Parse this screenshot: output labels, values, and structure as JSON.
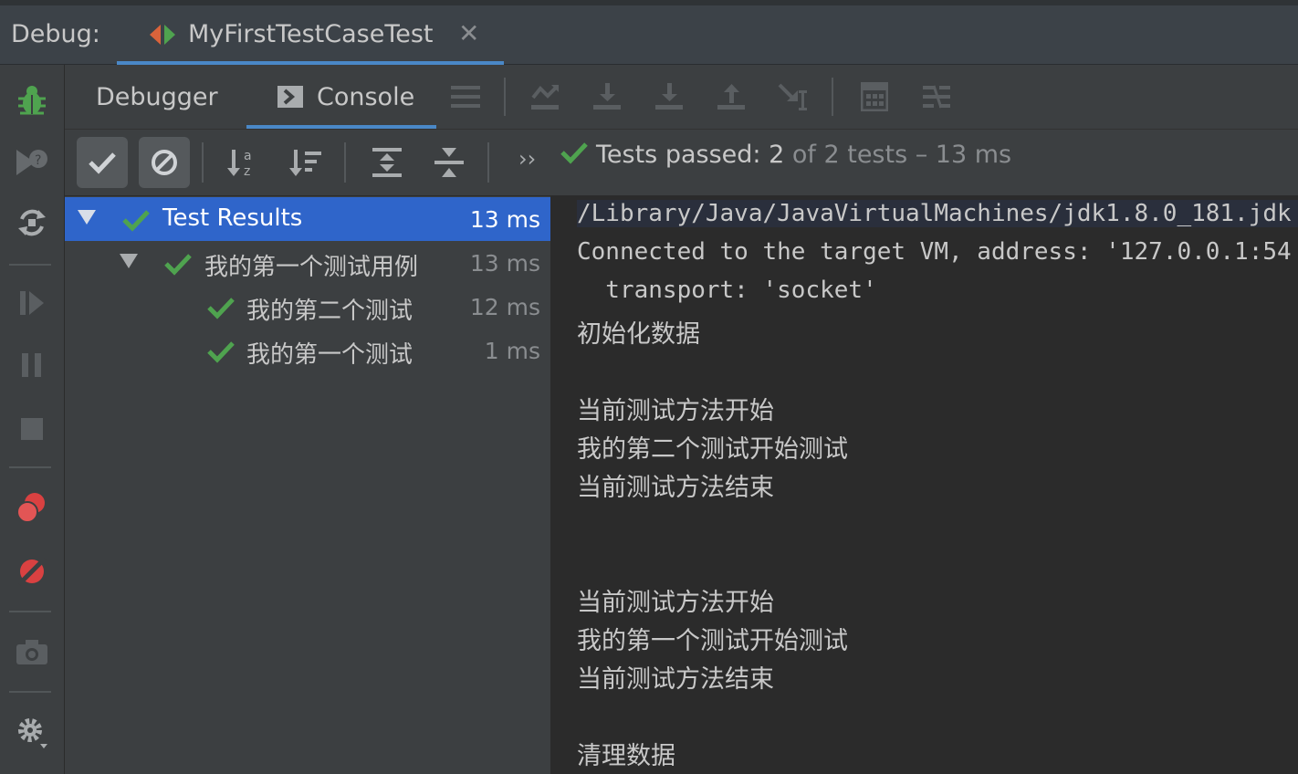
{
  "colors": {
    "accent": "#4a88c7",
    "selected": "#2f65ca",
    "pass": "#4fa34f",
    "bug": "#4fa34f",
    "stop": "#d94141"
  },
  "debug": {
    "label": "Debug:",
    "tab_title": "MyFirstTestCaseTest",
    "close": "✕"
  },
  "tabs": {
    "debugger": "Debugger",
    "console": "Console"
  },
  "status": {
    "passed_label": "Tests passed:",
    "passed_count": "2",
    "rest": "of 2 tests – 13 ms",
    "more": "››"
  },
  "tree": [
    {
      "label": "Test Results",
      "time": "13 ms"
    },
    {
      "label": "我的第一个测试用例",
      "time": "13 ms"
    },
    {
      "label": "我的第二个测试",
      "time": "12 ms"
    },
    {
      "label": "我的第一个测试",
      "time": "1 ms"
    }
  ],
  "console": {
    "lines": [
      "/Library/Java/JavaVirtualMachines/jdk1.8.0_181.jdk",
      "Connected to the target VM, address: '127.0.0.1:54",
      "  transport: 'socket'",
      "初始化数据",
      "当前测试方法开始",
      "我的第二个测试开始测试",
      "当前测试方法结束",
      "当前测试方法开始",
      "我的第一个测试开始测试",
      "当前测试方法结束",
      "清理数据"
    ]
  }
}
